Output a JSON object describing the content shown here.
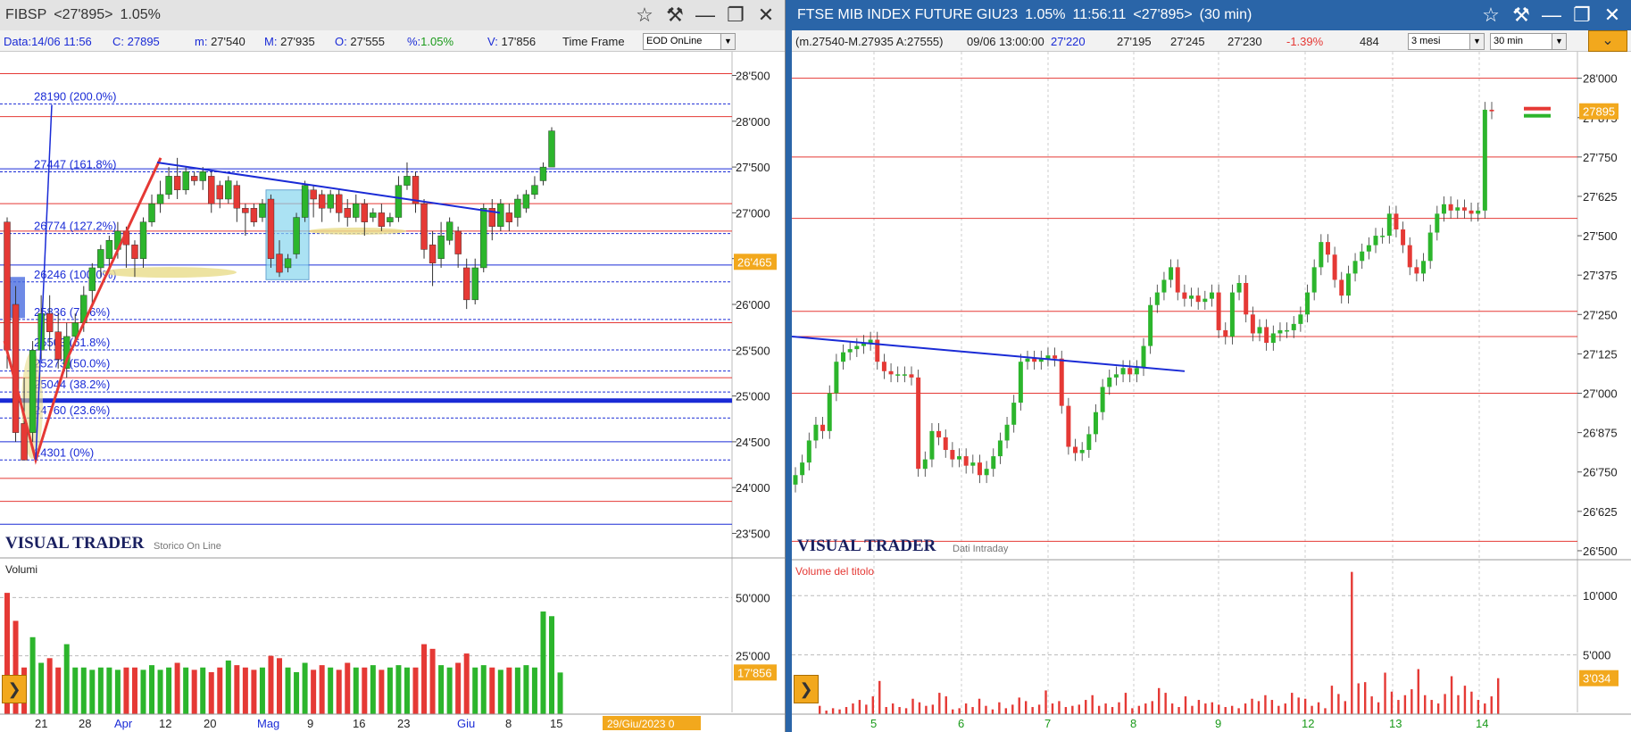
{
  "left": {
    "title": {
      "symbol": "FIBSP",
      "price": "<27'895>",
      "change": "1.05%"
    },
    "info": {
      "date_label": "Data:",
      "date": "14/06 11:56",
      "close_label": "C:",
      "close": "27895",
      "low_label": "m:",
      "low": "27'540",
      "high_label": "M:",
      "high": "27'935",
      "open_label": "O:",
      "open": "27'555",
      "pct_label": "%:",
      "pct": "1.05%",
      "vol_label": "V:",
      "vol": "17'856",
      "timeframe_label": "Time Frame",
      "timeframe_value": "EOD OnLine"
    },
    "brand": "VISUAL TRADER",
    "brand_sub": "Storico On Line",
    "volume_title": "Volumi",
    "date_badge": "29/Giu/2023 0",
    "price_badge": "26'465",
    "volume_badge": "17'856",
    "accent_red": "#e53935",
    "accent_green": "#2cb52c",
    "fib_color": "#1a2bd6"
  },
  "right": {
    "title": {
      "name": "FTSE MIB INDEX FUTURE GIU23",
      "change": "1.05%",
      "time": "11:56:11",
      "price": "<27'895>",
      "period": "(30 min)"
    },
    "info": {
      "bar": "(m.27540-M.27935 A:27555)",
      "bar_time": "09/06 13:00:00",
      "v1": "27'220",
      "v2": "27'195",
      "v3": "27'245",
      "v4": "27'230",
      "pct": "-1.39%",
      "vol": "484",
      "range_value": "3 mesi",
      "period_value": "30 min"
    },
    "brand": "VISUAL TRADER",
    "brand_sub": "Dati Intraday",
    "volume_title": "Volume del titolo",
    "price_badge": "27895",
    "volume_badge": "3'034"
  },
  "chart_data": [
    {
      "type": "candlestick",
      "title": "FIBSP",
      "ylim": [
        23300,
        28700
      ],
      "y_ticks": [
        "28'500",
        "28'000",
        "27'500",
        "27'000",
        "26'500",
        "26'000",
        "25'500",
        "25'000",
        "24'500",
        "24'000",
        "23'500"
      ],
      "x_ticks": [
        "21",
        "28",
        "Apr",
        "12",
        "20",
        "Mag",
        "9",
        "16",
        "23",
        "Giu",
        "8",
        "15"
      ],
      "fib_levels": [
        {
          "value": 28190,
          "label": "28190 (200.0%)"
        },
        {
          "value": 27447,
          "label": "27447 (161.8%)"
        },
        {
          "value": 26774,
          "label": "26774 (127.2%)"
        },
        {
          "value": 26246,
          "label": "26246 (100.0%)"
        },
        {
          "value": 25836,
          "label": "25836 (78.6%)"
        },
        {
          "value": 25503,
          "label": "25503 (61.8%)"
        },
        {
          "value": 25273,
          "label": "25273 (50.0%)"
        },
        {
          "value": 25044,
          "label": "25044 (38.2%)"
        },
        {
          "value": 24760,
          "label": "24760 (23.6%)"
        },
        {
          "value": 24301,
          "label": "24301 (0%)"
        }
      ],
      "horizontal_lines": [
        28520,
        28050,
        27480,
        27100,
        26800,
        26430,
        25800,
        25200,
        24500,
        24100,
        23850,
        23600
      ],
      "candles": [
        {
          "o": 26900,
          "c": 25500,
          "h": 26950,
          "l": 25300
        },
        {
          "o": 26000,
          "c": 24600,
          "h": 26200,
          "l": 24500
        },
        {
          "o": 24700,
          "c": 24300,
          "h": 25200,
          "l": 24301
        },
        {
          "o": 24600,
          "c": 25500,
          "h": 25600,
          "l": 24500
        },
        {
          "o": 25500,
          "c": 25900,
          "h": 26100,
          "l": 25400
        },
        {
          "o": 25900,
          "c": 25700,
          "h": 26100,
          "l": 25500
        },
        {
          "o": 25700,
          "c": 25400,
          "h": 25900,
          "l": 25300
        },
        {
          "o": 25300,
          "c": 25650,
          "h": 25800,
          "l": 25200
        },
        {
          "o": 25650,
          "c": 25800,
          "h": 25900,
          "l": 25550
        },
        {
          "o": 25800,
          "c": 26100,
          "h": 26200,
          "l": 25700
        },
        {
          "o": 26150,
          "c": 26400,
          "h": 26450,
          "l": 26000
        },
        {
          "o": 26400,
          "c": 26600,
          "h": 26650,
          "l": 26300
        },
        {
          "o": 26500,
          "c": 26700,
          "h": 26750,
          "l": 26400
        },
        {
          "o": 26600,
          "c": 26800,
          "h": 26900,
          "l": 26500
        },
        {
          "o": 26800,
          "c": 26650,
          "h": 26850,
          "l": 26400
        },
        {
          "o": 26650,
          "c": 26500,
          "h": 26700,
          "l": 26300
        },
        {
          "o": 26500,
          "c": 26900,
          "h": 26950,
          "l": 26400
        },
        {
          "o": 26900,
          "c": 27100,
          "h": 27200,
          "l": 26850
        },
        {
          "o": 27100,
          "c": 27200,
          "h": 27350,
          "l": 27000
        },
        {
          "o": 27200,
          "c": 27400,
          "h": 27500,
          "l": 27150
        },
        {
          "o": 27400,
          "c": 27250,
          "h": 27600,
          "l": 27150
        },
        {
          "o": 27250,
          "c": 27450,
          "h": 27500,
          "l": 27200
        },
        {
          "o": 27400,
          "c": 27350,
          "h": 27450,
          "l": 27300
        },
        {
          "o": 27350,
          "c": 27450,
          "h": 27500,
          "l": 27250
        },
        {
          "o": 27400,
          "c": 27100,
          "h": 27450,
          "l": 27000
        },
        {
          "o": 27300,
          "c": 27150,
          "h": 27350,
          "l": 27050
        },
        {
          "o": 27150,
          "c": 27350,
          "h": 27400,
          "l": 27100
        },
        {
          "o": 27300,
          "c": 27050,
          "h": 27350,
          "l": 26900
        },
        {
          "o": 27050,
          "c": 27000,
          "h": 27100,
          "l": 26750
        },
        {
          "o": 27050,
          "c": 26900,
          "h": 27100,
          "l": 26850
        },
        {
          "o": 26950,
          "c": 27100,
          "h": 27150,
          "l": 26900
        },
        {
          "o": 27150,
          "c": 26500,
          "h": 27200,
          "l": 26400
        },
        {
          "o": 26550,
          "c": 26350,
          "h": 26700,
          "l": 26300
        },
        {
          "o": 26400,
          "c": 26500,
          "h": 26550,
          "l": 26350
        },
        {
          "o": 26550,
          "c": 26950,
          "h": 27000,
          "l": 26500
        },
        {
          "o": 26950,
          "c": 27300,
          "h": 27350,
          "l": 26900
        },
        {
          "o": 27250,
          "c": 27150,
          "h": 27300,
          "l": 26950
        },
        {
          "o": 27200,
          "c": 27050,
          "h": 27250,
          "l": 26900
        },
        {
          "o": 27050,
          "c": 27200,
          "h": 27250,
          "l": 27000
        },
        {
          "o": 27200,
          "c": 27000,
          "h": 27250,
          "l": 26900
        },
        {
          "o": 27050,
          "c": 26950,
          "h": 27150,
          "l": 26850
        },
        {
          "o": 26950,
          "c": 27100,
          "h": 27200,
          "l": 26900
        },
        {
          "o": 27100,
          "c": 26900,
          "h": 27150,
          "l": 26750
        },
        {
          "o": 26950,
          "c": 27000,
          "h": 27050,
          "l": 26900
        },
        {
          "o": 27000,
          "c": 26850,
          "h": 27100,
          "l": 26800
        },
        {
          "o": 26900,
          "c": 26950,
          "h": 27000,
          "l": 26850
        },
        {
          "o": 26950,
          "c": 27300,
          "h": 27400,
          "l": 26900
        },
        {
          "o": 27300,
          "c": 27400,
          "h": 27550,
          "l": 27250
        },
        {
          "o": 27400,
          "c": 27100,
          "h": 27450,
          "l": 27000
        },
        {
          "o": 27100,
          "c": 26600,
          "h": 27150,
          "l": 26500
        },
        {
          "o": 26650,
          "c": 26450,
          "h": 26800,
          "l": 26200
        },
        {
          "o": 26500,
          "c": 26750,
          "h": 26900,
          "l": 26400
        },
        {
          "o": 26700,
          "c": 26900,
          "h": 26950,
          "l": 26650
        },
        {
          "o": 26800,
          "c": 26550,
          "h": 26850,
          "l": 26400
        },
        {
          "o": 26400,
          "c": 26050,
          "h": 26500,
          "l": 25950
        },
        {
          "o": 26050,
          "c": 26400,
          "h": 26500,
          "l": 26000
        },
        {
          "o": 26400,
          "c": 27050,
          "h": 27100,
          "l": 26350
        },
        {
          "o": 27050,
          "c": 26850,
          "h": 27150,
          "l": 26700
        },
        {
          "o": 26850,
          "c": 27100,
          "h": 27150,
          "l": 26800
        },
        {
          "o": 27000,
          "c": 26900,
          "h": 27100,
          "l": 26800
        },
        {
          "o": 26950,
          "c": 27150,
          "h": 27200,
          "l": 26850
        },
        {
          "o": 27050,
          "c": 27200,
          "h": 27250,
          "l": 27000
        },
        {
          "o": 27200,
          "c": 27300,
          "h": 27400,
          "l": 27150
        },
        {
          "o": 27350,
          "c": 27500,
          "h": 27550,
          "l": 27300
        },
        {
          "o": 27500,
          "c": 27895,
          "h": 27935,
          "l": 27540
        }
      ],
      "volume_ticks": [
        "50'000",
        "25'000"
      ],
      "volumes": [
        52000,
        40000,
        20000,
        33000,
        22000,
        24000,
        20000,
        30000,
        20000,
        20000,
        19000,
        20000,
        20000,
        19000,
        20000,
        20000,
        19000,
        21000,
        19000,
        20000,
        22000,
        20000,
        19000,
        20000,
        18000,
        20000,
        23000,
        21000,
        20000,
        19000,
        20000,
        25000,
        24000,
        20000,
        18000,
        22000,
        19000,
        21000,
        20000,
        19000,
        22000,
        20000,
        20000,
        21000,
        19000,
        20000,
        21000,
        20000,
        20000,
        30000,
        28000,
        21000,
        20000,
        22000,
        26000,
        20000,
        21000,
        20000,
        19000,
        20000,
        20000,
        21000,
        20000,
        44000,
        42000,
        17856
      ]
    },
    {
      "type": "candlestick",
      "title": "FTSE MIB INDEX FUTURE GIU23 (30 min)",
      "ylim": [
        26480,
        28050
      ],
      "y_ticks": [
        "28'000",
        "27'875",
        "27'750",
        "27'625",
        "27'500",
        "27'375",
        "27'250",
        "27'125",
        "27'000",
        "26'875",
        "26'750",
        "26'625",
        "26'500"
      ],
      "x_ticks": [
        "5",
        "6",
        "7",
        "8",
        "9",
        "12",
        "13",
        "14"
      ],
      "horizontal_lines": [
        28000,
        27750,
        27555,
        27260,
        27180,
        27000,
        26530
      ],
      "close_series": [
        26740,
        26780,
        26850,
        26900,
        26880,
        27000,
        27100,
        27130,
        27140,
        27150,
        27160,
        27170,
        27100,
        27070,
        27060,
        27060,
        27060,
        27050,
        26760,
        26790,
        26880,
        26860,
        26820,
        26790,
        26800,
        26770,
        26780,
        26740,
        26760,
        26800,
        26850,
        26900,
        26970,
        27100,
        27110,
        27100,
        27110,
        27120,
        27110,
        26960,
        26830,
        26810,
        26820,
        26870,
        26940,
        27020,
        27050,
        27060,
        27080,
        27060,
        27080,
        27150,
        27280,
        27320,
        27360,
        27400,
        27320,
        27300,
        27310,
        27290,
        27300,
        27320,
        27200,
        27180,
        27320,
        27350,
        27250,
        27190,
        27210,
        27160,
        27190,
        27200,
        27200,
        27220,
        27250,
        27320,
        27400,
        27480,
        27440,
        27360,
        27310,
        27380,
        27420,
        27450,
        27470,
        27500,
        27500,
        27570,
        27520,
        27470,
        27400,
        27380,
        27420,
        27510,
        27570,
        27600,
        27580,
        27590,
        27580,
        27570,
        27580,
        27900,
        27895
      ],
      "volume_ticks": [
        "10'000",
        "5'000"
      ],
      "volumes": [
        700,
        300,
        500,
        400,
        600,
        900,
        1200,
        800,
        1500,
        2800,
        600,
        900,
        600,
        500,
        1300,
        1000,
        700,
        800,
        1800,
        1500,
        400,
        500,
        900,
        600,
        1300,
        700,
        400,
        1000,
        500,
        800,
        1400,
        1100,
        600,
        800,
        2000,
        900,
        1100,
        600,
        700,
        800,
        1200,
        1600,
        700,
        900,
        600,
        1000,
        1800,
        500,
        700,
        900,
        1100,
        2200,
        1800,
        900,
        600,
        1500,
        700,
        1200,
        900,
        1000,
        800,
        600,
        700,
        500,
        900,
        1300,
        1100,
        1600,
        1200,
        700,
        900,
        1800,
        1400,
        1300,
        700,
        1000,
        500,
        2400,
        1700,
        1100,
        12000,
        2600,
        2700,
        1500,
        1000,
        3500,
        1900,
        1200,
        1600,
        2100,
        3800,
        1600,
        1200,
        900,
        1700,
        3200,
        1600,
        2400,
        1900,
        1200,
        900,
        1500,
        3034
      ]
    }
  ]
}
